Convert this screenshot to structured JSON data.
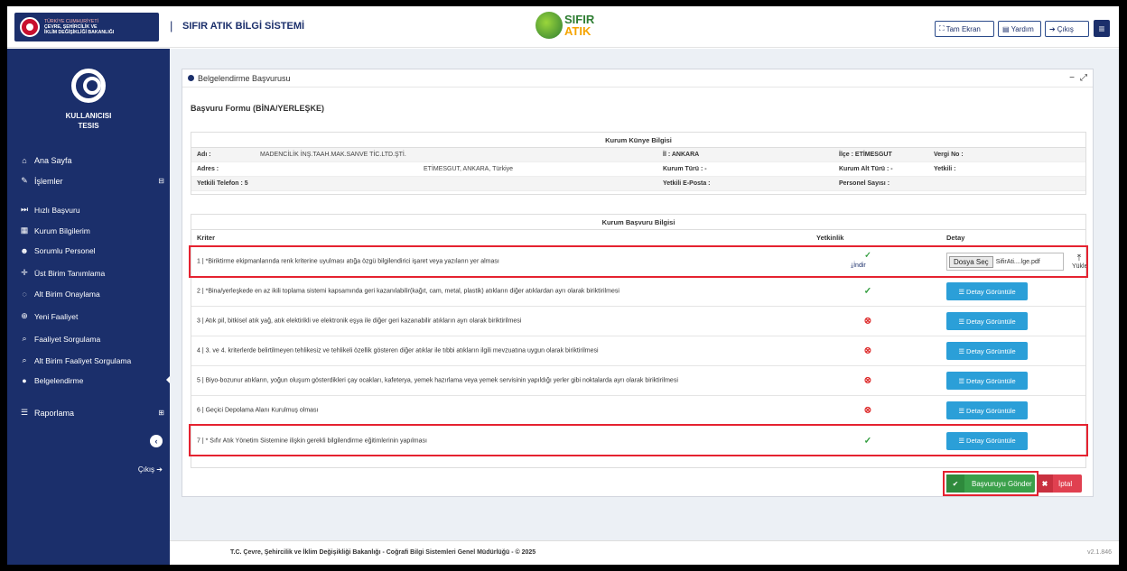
{
  "header": {
    "logo_line1": "TÜRKİYE CUMHURİYETİ",
    "logo_line2": "ÇEVRE, ŞEHİRCİLİK VE",
    "logo_line3": "İKLİM DEĞİŞİKLİĞİ BAKANLIĞI",
    "separator": "|",
    "app_title": "SIFIR ATIK BİLGİ SİSTEMİ",
    "center_logo_1": "SIFIR",
    "center_logo_2": "ATIK",
    "buttons": {
      "fullscreen": "Tam Ekran",
      "help": "Yardım",
      "logout": "Çıkış"
    }
  },
  "sidebar": {
    "user_name": "KULLANICISI",
    "user_role": "TESIS",
    "menu": [
      {
        "label": "Ana Sayfa",
        "icon": "home-icon"
      },
      {
        "label": "İşlemler",
        "icon": "edit-icon",
        "expand": "⊟"
      },
      {
        "label": "Hızlı Başvuru",
        "icon": "fast-forward-icon"
      },
      {
        "label": "Kurum Bilgilerim",
        "icon": "building-icon"
      },
      {
        "label": "Sorumlu Personel",
        "icon": "users-icon"
      },
      {
        "label": "Üst Birim Tanımlama",
        "icon": "arrows-icon"
      },
      {
        "label": "Alt Birim Onaylama",
        "icon": "circle-check-icon"
      },
      {
        "label": "Yeni Faaliyet",
        "icon": "plus-circle-icon"
      },
      {
        "label": "Faaliyet Sorgulama",
        "icon": "search-icon"
      },
      {
        "label": "Alt Birim Faaliyet Sorgulama",
        "icon": "search-icon"
      },
      {
        "label": "Belgelendirme",
        "icon": "dot-icon"
      },
      {
        "label": "Raporlama",
        "icon": "list-icon",
        "expand": "⊞"
      }
    ],
    "logout": "Çıkış"
  },
  "panel": {
    "title": "Belgelendirme Başvurusu",
    "form_title": "Başvuru Formu (BİNA/YERLEŞKE)"
  },
  "kunye": {
    "title": "Kurum Künye Bilgisi",
    "rows": [
      {
        "c1": "Adı :",
        "c2": "MADENCİLİK İNŞ.TAAH.MAK.SANVE TİC.LTD.ŞTİ.",
        "c3": "İl : ANKARA",
        "c4": "İlçe : ETİMESGUT",
        "c5": "Vergi No :"
      },
      {
        "c1": "Adres :",
        "c2": "ETİMESGUT, ANKARA, Türkiye",
        "c3": "Kurum Türü : -",
        "c4": "Kurum Alt Türü : -",
        "c5": "Yetkili :"
      },
      {
        "c1": "Yetkili Telefon : 5",
        "c2": "",
        "c3": "Yetkili E-Posta :",
        "c4": "Personel Sayısı :",
        "c5": ""
      }
    ]
  },
  "basvuru": {
    "title": "Kurum Başvuru Bilgisi",
    "col_kriter": "Kriter",
    "col_yetkinlik": "Yetkinlik",
    "col_detay": "Detay",
    "rows": [
      {
        "text": "1 | *Biriktirme ekipmanlarında renk kriterine uyulması atığa özgü bilgilendirici işaret veya yazıların yer alması",
        "status": "ok",
        "download": "İndir",
        "file_button": "Dosya Seç",
        "file_name": "SifirAti....lge.pdf",
        "upload": "Yükle"
      },
      {
        "text": "2 | *Bina/yerleşkede en az ikili toplama sistemi kapsamında geri kazanılabilir(kağıt, cam, metal, plastik) atıkların diğer atıklardan ayrı olarak biriktirilmesi",
        "status": "ok",
        "detail": "Detay Görüntüle"
      },
      {
        "text": "3 | Atık pil, bitkisel atık yağ, atık elektirikli ve elektronik eşya ile diğer geri kazanabilir atıkların ayrı olarak biriktirilmesi",
        "status": "bad",
        "detail": "Detay Görüntüle"
      },
      {
        "text": "4 | 3. ve 4. kriterlerde belirtilmeyen tehlikesiz ve tehlikeli özellik gösteren diğer atıklar ile tıbbi atıkların ilgili mevzuatına uygun olarak biriktirilmesi",
        "status": "bad",
        "detail": "Detay Görüntüle"
      },
      {
        "text": "5 | Biyo-bozunur atıkların, yoğun oluşum gösterdikleri çay ocakları, kafeterya, yemek hazırlama veya yemek servisinin yapıldığı yerler gibi noktalarda ayrı olarak biriktirilmesi",
        "status": "bad",
        "detail": "Detay Görüntüle"
      },
      {
        "text": "6 | Geçici Depolama Alanı Kurulmuş olması",
        "status": "bad",
        "detail": "Detay Görüntüle"
      },
      {
        "text": "7 | * Sıfır Atık Yönetim Sistemine ilişkin gerekli bilgilendirme eğitimlerinin yapılması",
        "status": "ok",
        "detail": "Detay Görüntüle"
      }
    ]
  },
  "actions": {
    "submit": "Başvuruyu Gönder",
    "cancel": "İptal"
  },
  "footer": {
    "text": "T.C. Çevre, Şehircilik ve İklim Değişikliği Bakanlığı - Coğrafi Bilgi Sistemleri Genel Müdürlüğü - © 2025",
    "version": "v2.1.846"
  },
  "colors": {
    "sidebar": "#1b2f6b",
    "ok": "#2e9b3a",
    "bad": "#dd2a2a",
    "detail_button": "#2b9fd8",
    "submit": "#3aa04a",
    "cancel": "#e04050",
    "highlight": "#e52230"
  }
}
